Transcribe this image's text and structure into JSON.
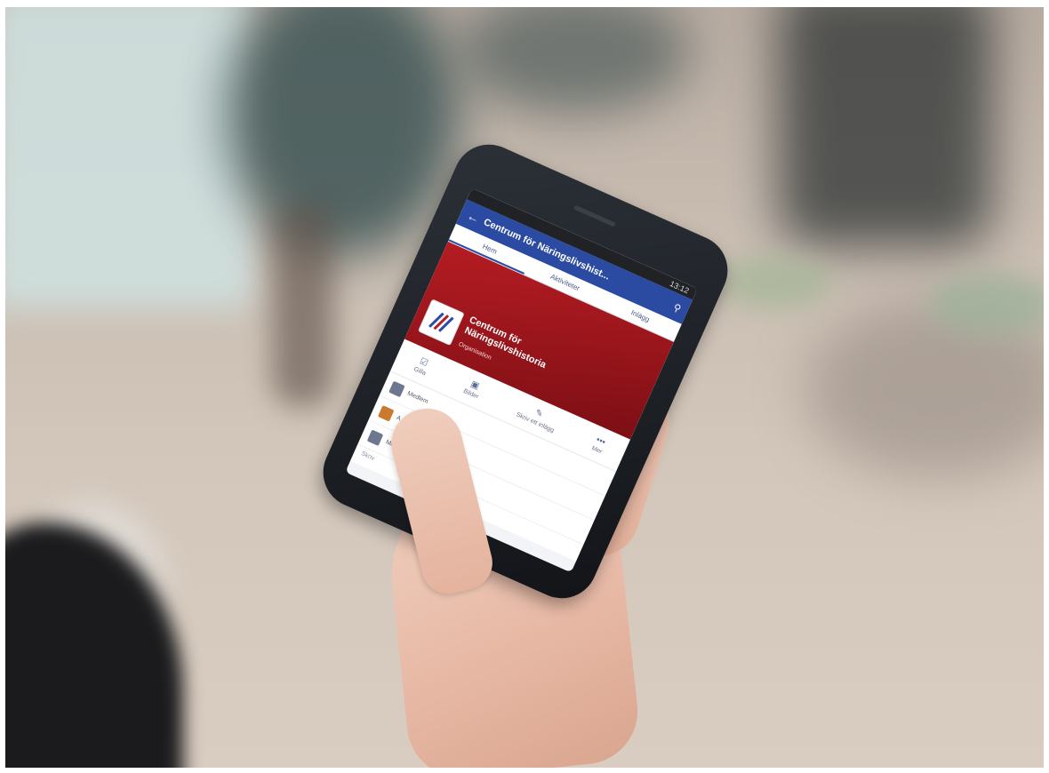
{
  "phone": {
    "status_time": "13:12",
    "app_title": "Centrum för Näringslivshist...",
    "icons": {
      "back": "arrow-left-icon",
      "search": "search-icon"
    },
    "tabs": [
      "Hem",
      "Aktiviteter",
      "Inlägg"
    ],
    "org_name": "Centrum för Näringslivshistoria",
    "org_type": "Organisation",
    "actions": [
      "Gilla",
      "Bilder",
      "Skriv ett inlägg",
      "Mer"
    ],
    "feed": [
      "Medlem",
      "A 222...",
      "Meddelande"
    ],
    "composer_placeholder": "Skriv"
  },
  "colors": {
    "app_bar": "#2b4ba3",
    "cover": "#b51c22"
  }
}
